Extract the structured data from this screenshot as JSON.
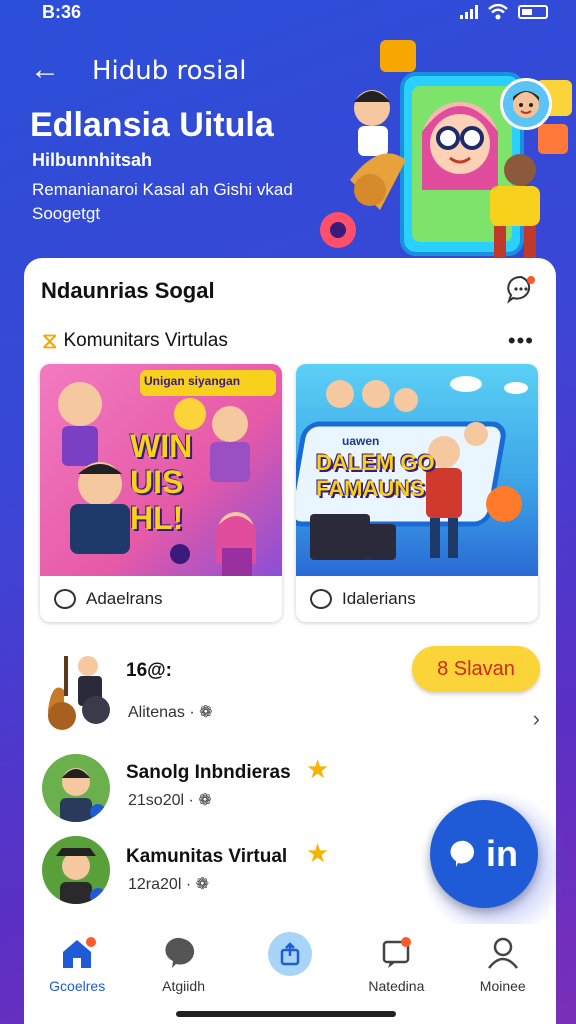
{
  "status": {
    "time": "B:36"
  },
  "header": {
    "back_icon": "arrow-left-icon",
    "title": "Hidub rosial",
    "hero_title": "Edlansia Uitula",
    "hero_subtitle": "Hilbunnhitsah",
    "hero_description": "Remanianaroi Kasal ah Gishi vkad Soogetgt"
  },
  "card": {
    "title": "Ndaunrias Sogal",
    "section_title": "Komunitars Virtulas",
    "tiles": [
      {
        "label": "Adaelrans",
        "overlay": "WIN UIS HL!",
        "banner": "Unigan siyangan"
      },
      {
        "label": "Idalerians",
        "overlay": "DALEM GO FAMAUNS",
        "banner": "uawen"
      }
    ],
    "join_button": "8 Slavan",
    "list": [
      {
        "name": "16@:",
        "meta": "Alitenas ·"
      },
      {
        "name": "Sanolg Inbndieras",
        "meta": "21so20l ·"
      },
      {
        "name": "Kamunitas Virtual",
        "meta": "12ra20l ·"
      }
    ]
  },
  "fab": {
    "label": "in"
  },
  "nav": [
    {
      "label": "Gcoelres",
      "icon": "home-icon",
      "active": true
    },
    {
      "label": "Atgiidh",
      "icon": "chat-bubble-icon",
      "active": false
    },
    {
      "label": "",
      "icon": "share-icon",
      "active": false
    },
    {
      "label": "Natedina",
      "icon": "notification-icon",
      "active": false
    },
    {
      "label": "Moinee",
      "icon": "profile-icon",
      "active": false
    }
  ]
}
